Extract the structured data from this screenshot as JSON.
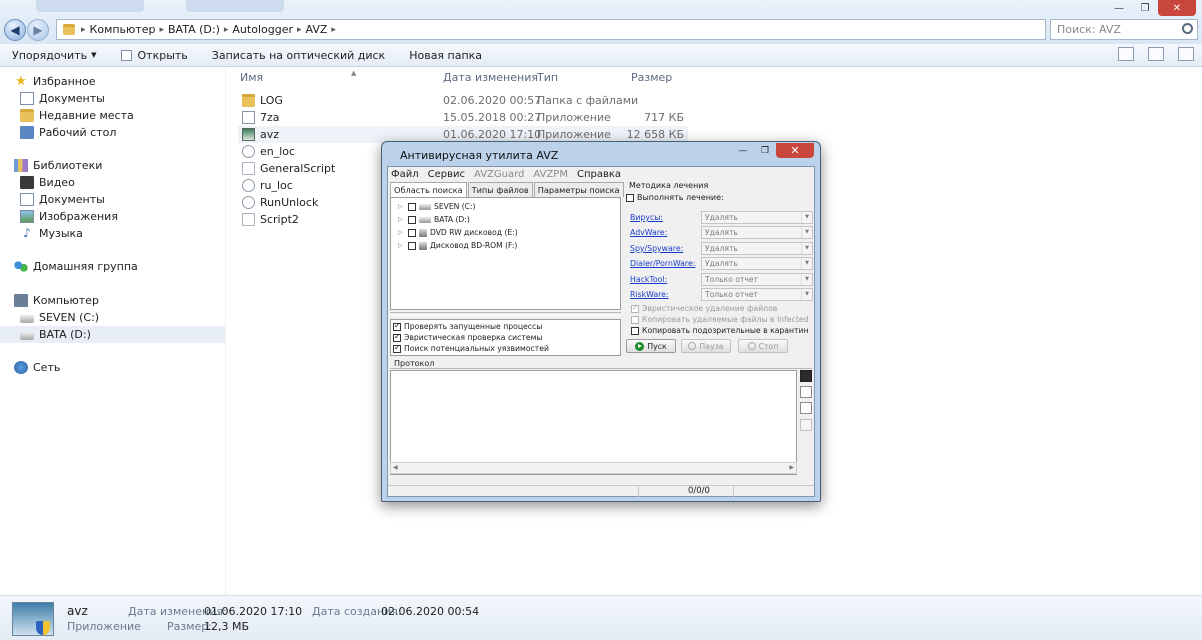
{
  "explorer": {
    "window_controls": {
      "minimize": "—",
      "maximize": "❐",
      "close": "✕"
    },
    "nav": {
      "back": "◀",
      "forward": "▶"
    },
    "address": [
      "Компьютер",
      "BATA (D:)",
      "Autologger",
      "AVZ"
    ],
    "search_placeholder": "Поиск: AVZ",
    "toolbar": {
      "organize": "Упорядочить",
      "open": "Открыть",
      "burn": "Записать на оптический диск",
      "new_folder": "Новая папка"
    },
    "sidebar": {
      "favorites": "Избранное",
      "documents": "Документы",
      "recent": "Недавние места",
      "desktop": "Рабочий стол",
      "libraries": "Библиотеки",
      "video": "Видео",
      "lib_documents": "Документы",
      "images": "Изображения",
      "music": "Музыка",
      "homegroup": "Домашняя группа",
      "computer": "Компьютер",
      "drive_c": "SEVEN (C:)",
      "drive_d": "BATA (D:)",
      "network": "Сеть"
    },
    "columns": {
      "name": "Имя",
      "date": "Дата изменения",
      "type": "Тип",
      "size": "Размер"
    },
    "files": [
      {
        "name": "LOG",
        "date": "02.06.2020 00:57",
        "type": "Папка с файлами",
        "size": "",
        "icon": "folder"
      },
      {
        "name": "7za",
        "date": "15.05.2018 00:27",
        "type": "Приложение",
        "size": "717 КБ",
        "icon": "exe"
      },
      {
        "name": "avz",
        "date": "01.06.2020 17:10",
        "type": "Приложение",
        "size": "12 658 КБ",
        "icon": "avz"
      },
      {
        "name": "en_loc",
        "date": "",
        "type": "",
        "size": "",
        "icon": "cfg"
      },
      {
        "name": "GeneralScript",
        "date": "",
        "type": "",
        "size": "",
        "icon": "file"
      },
      {
        "name": "ru_loc",
        "date": "",
        "type": "",
        "size": "",
        "icon": "cfg"
      },
      {
        "name": "RunUnlock",
        "date": "",
        "type": "",
        "size": "",
        "icon": "cfg"
      },
      {
        "name": "Script2",
        "date": "",
        "type": "",
        "size": "",
        "icon": "file"
      }
    ],
    "status": {
      "name": "avz",
      "kind": "Приложение",
      "modified_label": "Дата изменения:",
      "modified": "01.06.2020 17:10",
      "created_label": "Дата создания:",
      "created": "02.06.2020 00:54",
      "size_label": "Размер:",
      "size": "12,3 МБ"
    }
  },
  "avz": {
    "title": "Антивирусная утилита AVZ",
    "menu": [
      "Файл",
      "Сервис",
      "AVZGuard",
      "AVZPM",
      "Справка"
    ],
    "tabs": [
      "Область поиска",
      "Типы файлов",
      "Параметры поиска"
    ],
    "drives": [
      "SEVEN (C:)",
      "BATA (D:)",
      "DVD RW дисковод (E:)",
      "Дисковод BD-ROM (F:)"
    ],
    "options": [
      "Проверять запущенные процессы",
      "Эвристическая проверка системы",
      "Поиск потенциальных уязвимостей"
    ],
    "treatment_header": "Методика лечения",
    "perform_treatment": "Выполнять лечение:",
    "treat_rows": [
      {
        "label": "Вирусы:",
        "value": "Удалять"
      },
      {
        "label": "AdvWare:",
        "value": "Удалять"
      },
      {
        "label": "Spy/Spyware:",
        "value": "Удалять"
      },
      {
        "label": "Dialer/PornWare:",
        "value": "Удалять"
      },
      {
        "label": "HackTool:",
        "value": "Только отчет"
      },
      {
        "label": "RiskWare:",
        "value": "Только отчет"
      }
    ],
    "heur_delete": "Эвристическое удаление файлов",
    "copy_infected": "Копировать удаляемые файлы в  Infected",
    "copy_quarantine": "Копировать подозрительные в  карантин",
    "buttons": {
      "start": "Пуск",
      "pause": "Пауза",
      "stop": "Стоп"
    },
    "protocol": "Протокол",
    "counter": "0/0/0"
  }
}
